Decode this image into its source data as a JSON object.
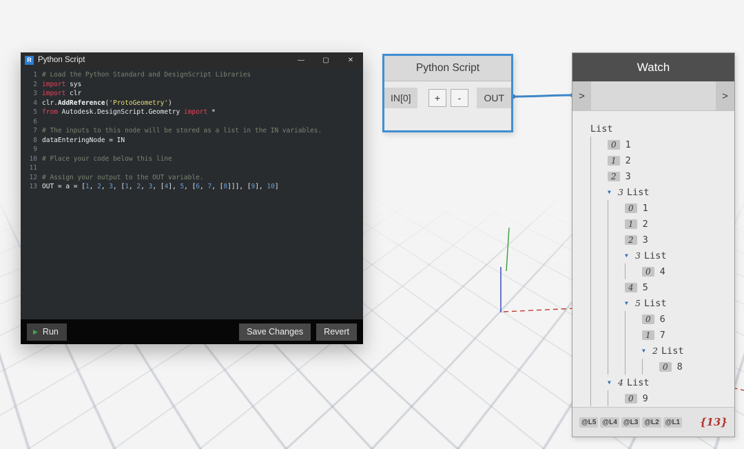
{
  "colors": {
    "wire_blue": "#3e86c8",
    "selection_border_blue": "#3f8fd2",
    "count_red": "#b5342d",
    "keyword_red": "#e8425c",
    "string_yellow": "#e6db74",
    "number_blue": "#6a9fd6",
    "comment_green": "#7a8570"
  },
  "icons": {
    "collapse": "▼",
    "play": "▶"
  },
  "editor": {
    "window_title": "Python Script",
    "window_icon_letter": "R",
    "controls": {
      "minimize": "—",
      "maximize": "▢",
      "close": "✕"
    },
    "code_lines": [
      {
        "n": 1,
        "segments": [
          {
            "t": "# Load the Python Standard and DesignScript Libraries",
            "c": "comment"
          }
        ]
      },
      {
        "n": 2,
        "segments": [
          {
            "t": "import",
            "c": "keyword"
          },
          {
            "t": " sys",
            "c": "plain"
          }
        ]
      },
      {
        "n": 3,
        "segments": [
          {
            "t": "import",
            "c": "keyword"
          },
          {
            "t": " clr",
            "c": "plain"
          }
        ]
      },
      {
        "n": 4,
        "segments": [
          {
            "t": "clr.",
            "c": "plain"
          },
          {
            "t": "AddReference",
            "c": "func"
          },
          {
            "t": "(",
            "c": "plain"
          },
          {
            "t": "'ProtoGeometry'",
            "c": "string"
          },
          {
            "t": ")",
            "c": "plain"
          }
        ]
      },
      {
        "n": 5,
        "segments": [
          {
            "t": "from",
            "c": "keyword"
          },
          {
            "t": " Autodesk.DesignScript.Geometry ",
            "c": "plain"
          },
          {
            "t": "import",
            "c": "keyword"
          },
          {
            "t": " *",
            "c": "plain"
          }
        ]
      },
      {
        "n": 6,
        "segments": []
      },
      {
        "n": 7,
        "segments": [
          {
            "t": "# The inputs to this node will be stored as a list in the IN variables.",
            "c": "comment"
          }
        ]
      },
      {
        "n": 8,
        "segments": [
          {
            "t": "dataEnteringNode = IN",
            "c": "plain"
          }
        ]
      },
      {
        "n": 9,
        "segments": []
      },
      {
        "n": 10,
        "segments": [
          {
            "t": "# Place your code below this line",
            "c": "comment"
          }
        ]
      },
      {
        "n": 11,
        "segments": []
      },
      {
        "n": 12,
        "segments": [
          {
            "t": "# Assign your output to the OUT variable.",
            "c": "comment"
          }
        ]
      },
      {
        "n": 13,
        "segments": [
          {
            "t": "OUT = a = [",
            "c": "plain"
          },
          {
            "t": "1",
            "c": "number"
          },
          {
            "t": ", ",
            "c": "plain"
          },
          {
            "t": "2",
            "c": "number"
          },
          {
            "t": ", ",
            "c": "plain"
          },
          {
            "t": "3",
            "c": "number"
          },
          {
            "t": ", [",
            "c": "plain"
          },
          {
            "t": "1",
            "c": "number"
          },
          {
            "t": ", ",
            "c": "plain"
          },
          {
            "t": "2",
            "c": "number"
          },
          {
            "t": ", ",
            "c": "plain"
          },
          {
            "t": "3",
            "c": "number"
          },
          {
            "t": ", [",
            "c": "plain"
          },
          {
            "t": "4",
            "c": "number"
          },
          {
            "t": "], ",
            "c": "plain"
          },
          {
            "t": "5",
            "c": "number"
          },
          {
            "t": ", [",
            "c": "plain"
          },
          {
            "t": "6",
            "c": "number"
          },
          {
            "t": ", ",
            "c": "plain"
          },
          {
            "t": "7",
            "c": "number"
          },
          {
            "t": ", [",
            "c": "plain"
          },
          {
            "t": "8",
            "c": "number"
          },
          {
            "t": "]]], [",
            "c": "plain"
          },
          {
            "t": "9",
            "c": "number"
          },
          {
            "t": "], ",
            "c": "plain"
          },
          {
            "t": "10",
            "c": "number"
          },
          {
            "t": "]",
            "c": "plain"
          }
        ]
      }
    ],
    "footer": {
      "play_icon": "▶",
      "run_label": "Run",
      "save_label": "Save Changes",
      "revert_label": "Revert"
    }
  },
  "python_node": {
    "title": "Python Script",
    "ports_in": [
      "IN[0]"
    ],
    "add_button": "+",
    "remove_button": "-",
    "out_port": "OUT"
  },
  "watch_node": {
    "title": "Watch",
    "input_port": ">",
    "output_port": ">",
    "tree": [
      {
        "indent": 0,
        "kind": "list",
        "arrow": false,
        "index": null,
        "label": "List"
      },
      {
        "indent": 1,
        "kind": "item",
        "index": "0",
        "value": "1"
      },
      {
        "indent": 1,
        "kind": "item",
        "index": "1",
        "value": "2"
      },
      {
        "indent": 1,
        "kind": "item",
        "index": "2",
        "value": "3"
      },
      {
        "indent": 1,
        "kind": "list",
        "arrow": true,
        "index": "3",
        "label": "List"
      },
      {
        "indent": 2,
        "kind": "item",
        "index": "0",
        "value": "1"
      },
      {
        "indent": 2,
        "kind": "item",
        "index": "1",
        "value": "2"
      },
      {
        "indent": 2,
        "kind": "item",
        "index": "2",
        "value": "3"
      },
      {
        "indent": 2,
        "kind": "list",
        "arrow": true,
        "index": "3",
        "label": "List"
      },
      {
        "indent": 3,
        "kind": "item",
        "index": "0",
        "value": "4"
      },
      {
        "indent": 2,
        "kind": "item",
        "index": "4",
        "value": "5"
      },
      {
        "indent": 2,
        "kind": "list",
        "arrow": true,
        "index": "5",
        "label": "List"
      },
      {
        "indent": 3,
        "kind": "item",
        "index": "0",
        "value": "6"
      },
      {
        "indent": 3,
        "kind": "item",
        "index": "1",
        "value": "7"
      },
      {
        "indent": 3,
        "kind": "list",
        "arrow": true,
        "index": "2",
        "label": "List"
      },
      {
        "indent": 4,
        "kind": "item",
        "index": "0",
        "value": "8"
      },
      {
        "indent": 1,
        "kind": "list",
        "arrow": true,
        "index": "4",
        "label": "List"
      },
      {
        "indent": 2,
        "kind": "item",
        "index": "0",
        "value": "9"
      }
    ],
    "footer": {
      "levels": [
        "@L5",
        "@L4",
        "@L3",
        "@L2",
        "@L1"
      ],
      "count": "{13}"
    }
  }
}
